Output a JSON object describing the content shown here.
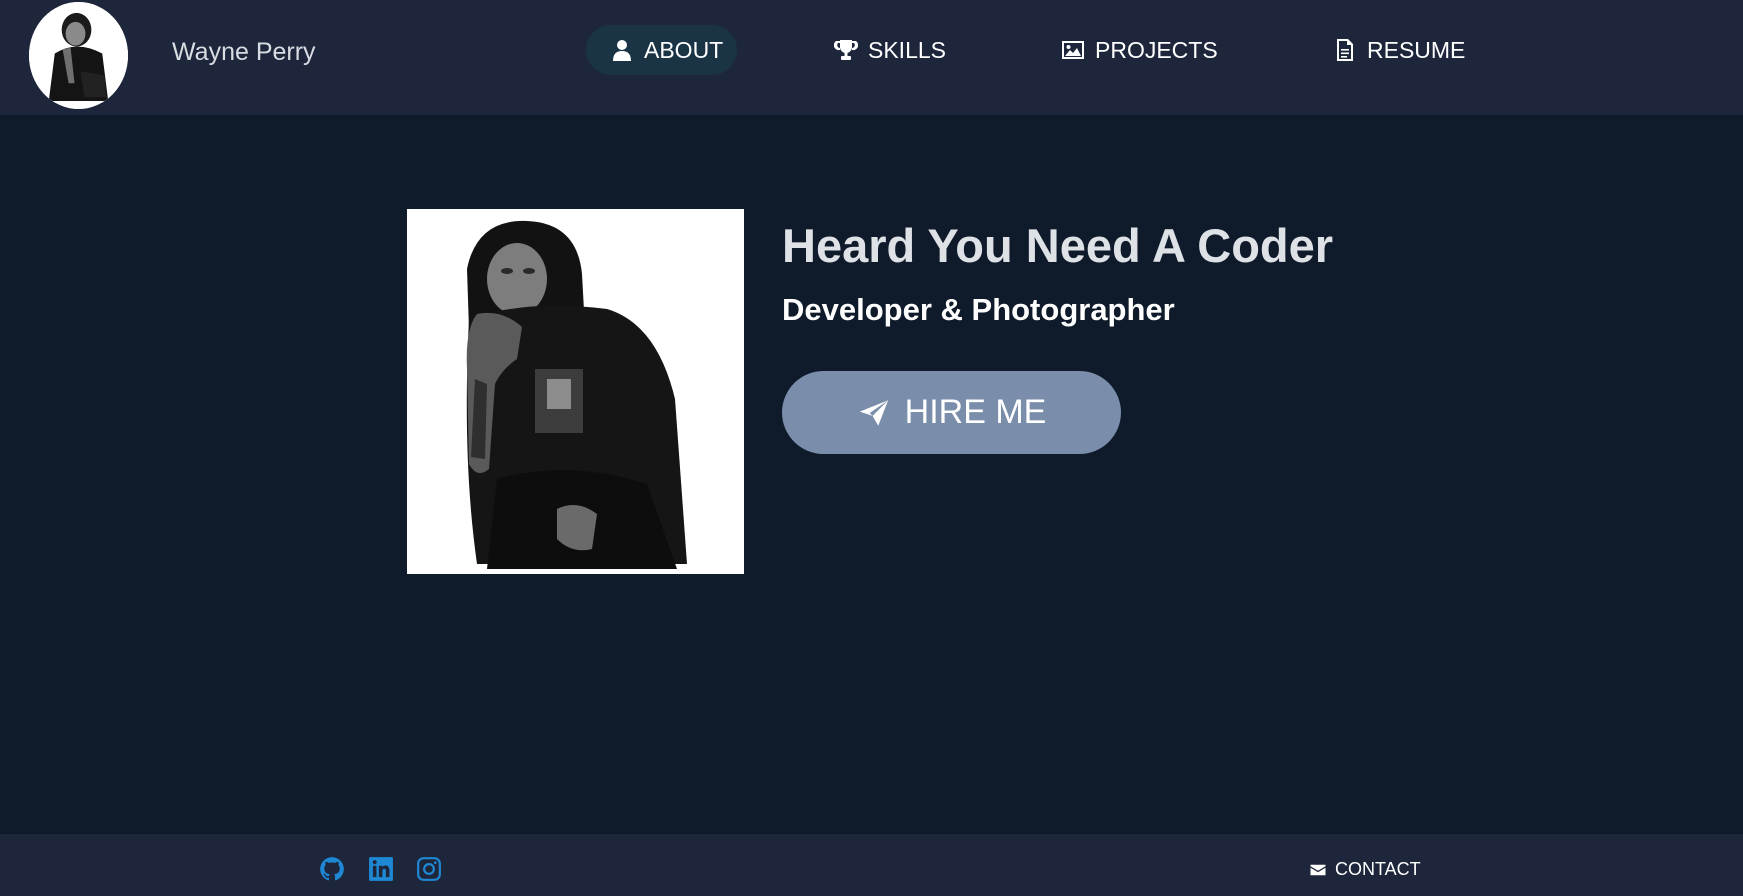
{
  "header": {
    "brand_name": "Wayne Perry",
    "avatar_alt": "Wayne Perry avatar",
    "nav": [
      {
        "label": "ABOUT",
        "icon": "user-icon",
        "active": true
      },
      {
        "label": "SKILLS",
        "icon": "trophy-icon",
        "active": false
      },
      {
        "label": "PROJECTS",
        "icon": "image-icon",
        "active": false
      },
      {
        "label": "RESUME",
        "icon": "document-icon",
        "active": false
      }
    ]
  },
  "hero": {
    "title": "Heard You Need A Coder",
    "subtitle": "Developer & Photographer",
    "cta_label": "HIRE ME",
    "cta_icon": "paper-plane-icon"
  },
  "footer": {
    "social": [
      {
        "icon": "github-icon"
      },
      {
        "icon": "linkedin-icon"
      },
      {
        "icon": "instagram-icon"
      }
    ],
    "contact_label": "CONTACT",
    "contact_icon": "envelope-icon"
  },
  "colors": {
    "page_background": "#0f1a2a",
    "bar_background": "#1d263b",
    "active_nav_background": "#1a3446",
    "cta_background": "#7a8eab",
    "social_icon": "#1e88d4"
  }
}
